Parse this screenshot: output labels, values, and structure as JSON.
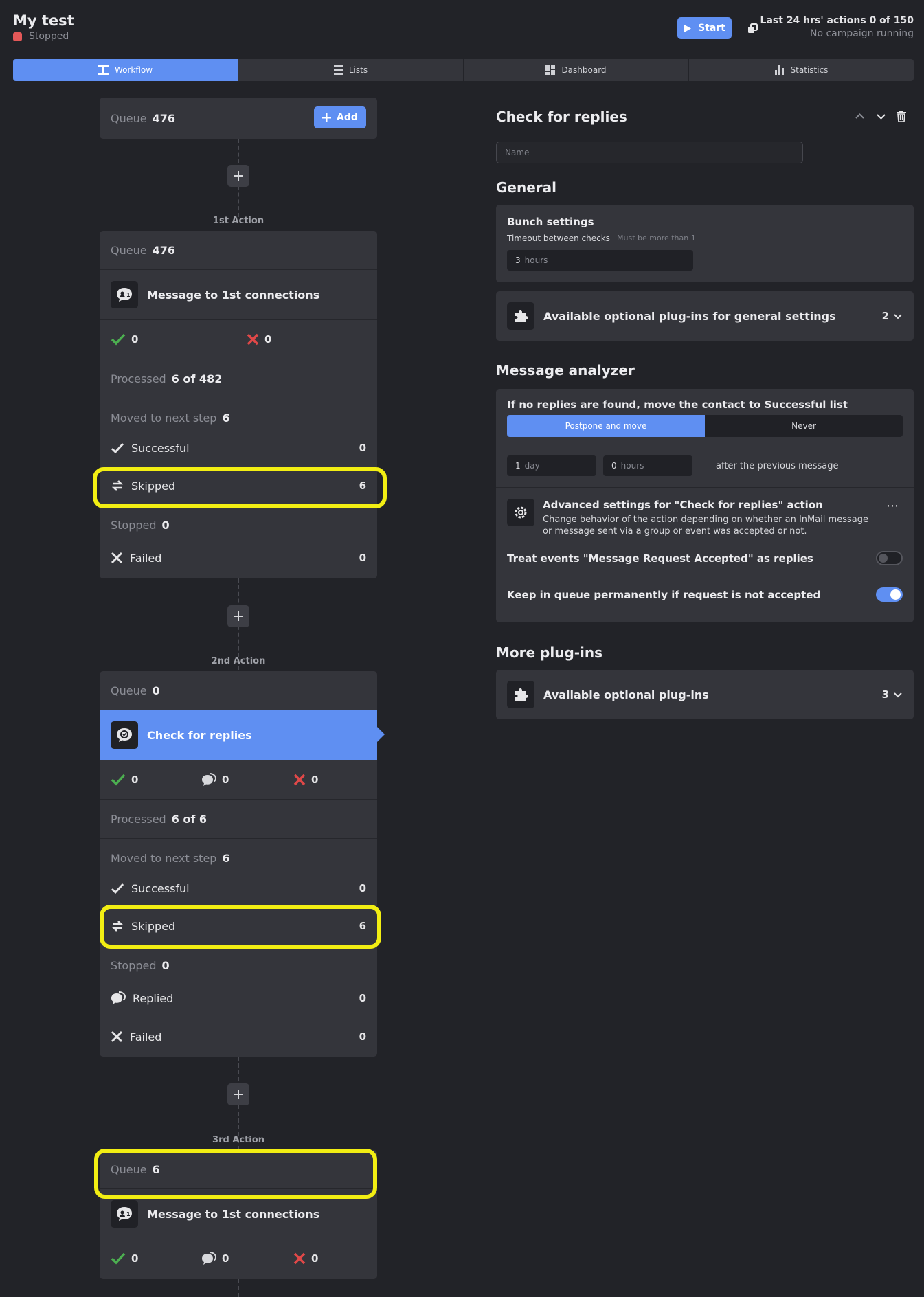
{
  "header": {
    "title": "My test",
    "status": "Stopped",
    "start_label": "Start",
    "actions_line1": "Last 24 hrs' actions 0 of 150",
    "actions_line2": "No campaign running"
  },
  "tabs": [
    {
      "label": "Workflow",
      "icon": "workflow-icon",
      "active": true
    },
    {
      "label": "Lists",
      "icon": "list-icon"
    },
    {
      "label": "Dashboard",
      "icon": "dashboard-icon"
    },
    {
      "label": "Statistics",
      "icon": "bar-chart-icon"
    }
  ],
  "flow": {
    "top_queue": {
      "label": "Queue",
      "value": "476",
      "add_label": "Add"
    },
    "actions": [
      {
        "step_label": "1st Action",
        "queue_label": "Queue",
        "queue_value": "476",
        "title": "Message to 1st connections",
        "success_count": "0",
        "fail_count": "0",
        "processed_label": "Processed",
        "processed_value": "6 of 482",
        "moved_label": "Moved to next step",
        "moved_value": "6",
        "successful_label": "Successful",
        "successful_value": "0",
        "skipped_label": "Skipped",
        "skipped_value": "6",
        "stopped_label": "Stopped",
        "stopped_value": "0",
        "failed_label": "Failed",
        "failed_value": "0"
      },
      {
        "step_label": "2nd Action",
        "queue_label": "Queue",
        "queue_value": "0",
        "title": "Check for replies",
        "success_count": "0",
        "reply_count": "0",
        "fail_count": "0",
        "processed_label": "Processed",
        "processed_value": "6 of 6",
        "moved_label": "Moved to next step",
        "moved_value": "6",
        "successful_label": "Successful",
        "successful_value": "0",
        "skipped_label": "Skipped",
        "skipped_value": "6",
        "stopped_label": "Stopped",
        "stopped_value": "0",
        "replied_label": "Replied",
        "replied_value": "0",
        "failed_label": "Failed",
        "failed_value": "0"
      },
      {
        "step_label": "3rd Action",
        "queue_label": "Queue",
        "queue_value": "6",
        "title": "Message to 1st connections",
        "success_count": "0",
        "reply_count": "0",
        "fail_count": "0"
      }
    ]
  },
  "panel": {
    "title": "Check for replies",
    "name_placeholder": "Name",
    "general": {
      "heading": "General",
      "bunch_title": "Bunch settings",
      "timeout_label": "Timeout between checks",
      "timeout_hint": "Must be more than 1",
      "timeout_value": "3",
      "timeout_unit": "hours",
      "plugins_label": "Available optional plug-ins for general settings",
      "plugins_count": "2"
    },
    "analyzer": {
      "heading": "Message analyzer",
      "rule_label": "If no replies are found, move the contact to Successful list",
      "option_on": "Postpone and move",
      "option_off": "Never",
      "days_value": "1",
      "days_unit": "day",
      "hours_value": "0",
      "hours_unit": "hours",
      "after_text": "after the previous message",
      "adv_title": "Advanced settings for \"Check for replies\" action",
      "adv_desc": "Change behavior of the action depending on whether an InMail message or message sent via a group or event was accepted or not.",
      "toggle1_label": "Treat events \"Message Request Accepted\" as replies",
      "toggle2_label": "Keep in queue permanently if request is not accepted"
    },
    "more": {
      "heading": "More plug-ins",
      "plugins_label": "Available optional plug-ins",
      "plugins_count": "3"
    }
  },
  "colors": {
    "accent": "#5f8ff2",
    "highlight": "#f2ee13",
    "success": "#4caf50",
    "fail": "#e04848",
    "stopped": "#e45858"
  }
}
